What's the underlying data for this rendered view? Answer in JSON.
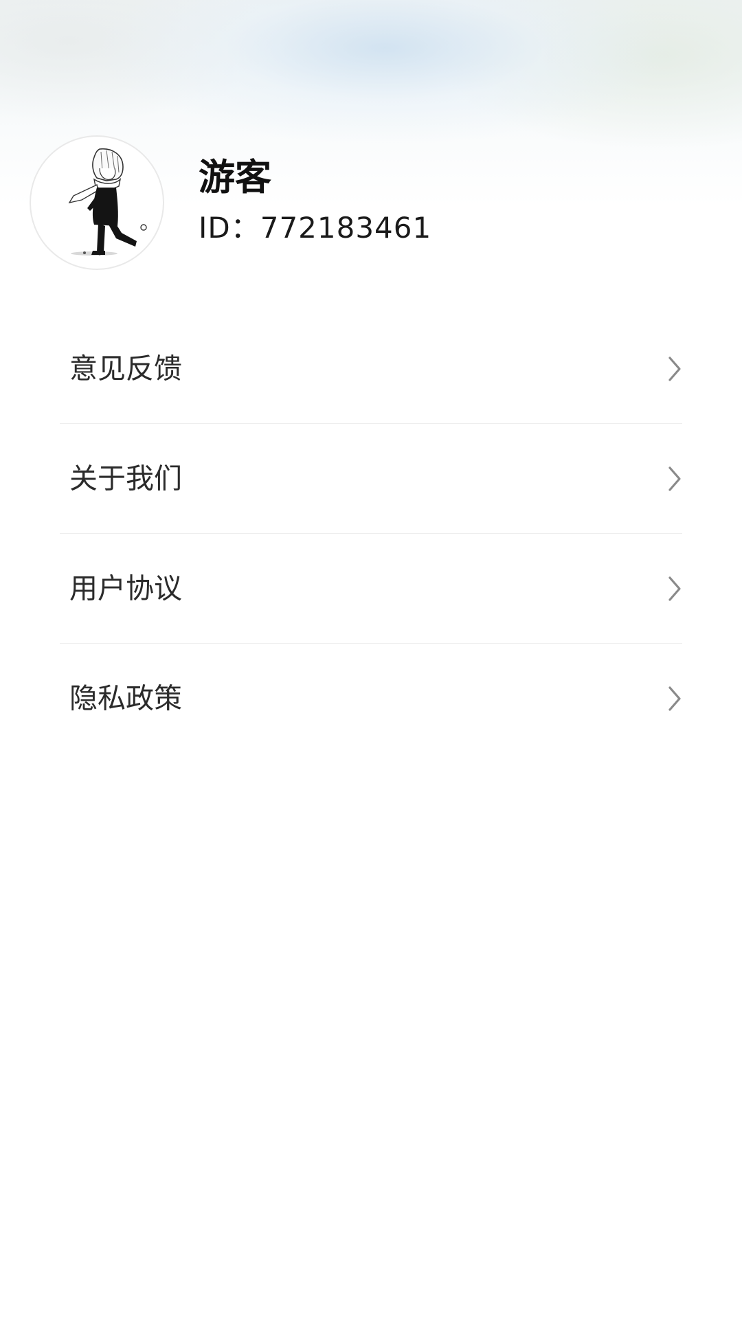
{
  "profile": {
    "name": "游客",
    "id_text": "ID：772183461",
    "avatar_icon": "anime-boy-avatar"
  },
  "menu": {
    "items": [
      {
        "label": "意见反馈",
        "icon": "chevron-right-icon"
      },
      {
        "label": "关于我们",
        "icon": "chevron-right-icon"
      },
      {
        "label": "用户协议",
        "icon": "chevron-right-icon"
      },
      {
        "label": "隐私政策",
        "icon": "chevron-right-icon"
      }
    ]
  },
  "colors": {
    "text_primary": "#111111",
    "menu_text": "#2b2b2b",
    "chevron": "#8a8a8a",
    "divider": "#eeeeee",
    "header_tint": "#cde0f0"
  }
}
